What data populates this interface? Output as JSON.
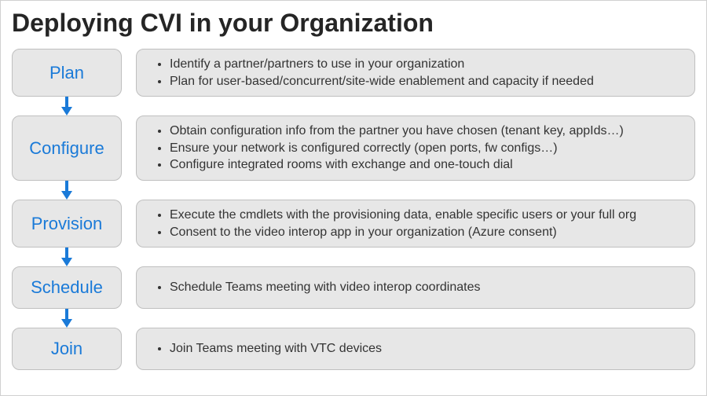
{
  "title": "Deploying CVI in your Organization",
  "colors": {
    "stepText": "#1a7ad8",
    "boxFill": "#e7e7e7",
    "boxBorder": "#bfbfbf",
    "arrow": "#1a7ad8"
  },
  "steps": [
    {
      "name": "Plan",
      "bullets": [
        "Identify a partner/partners to use in your organization",
        "Plan for user-based/concurrent/site-wide enablement and capacity if needed"
      ]
    },
    {
      "name": "Configure",
      "bullets": [
        "Obtain configuration info from the partner you have chosen (tenant key, appIds…)",
        "Ensure your network is configured correctly (open ports, fw configs…)",
        "Configure integrated rooms with exchange and one-touch dial"
      ]
    },
    {
      "name": "Provision",
      "bullets": [
        "Execute the cmdlets with the provisioning data, enable specific users or your full org",
        "Consent to the video interop app in your organization (Azure consent)"
      ]
    },
    {
      "name": "Schedule",
      "bullets": [
        "Schedule Teams meeting with video interop coordinates"
      ]
    },
    {
      "name": "Join",
      "bullets": [
        "Join Teams meeting with VTC devices"
      ]
    }
  ]
}
